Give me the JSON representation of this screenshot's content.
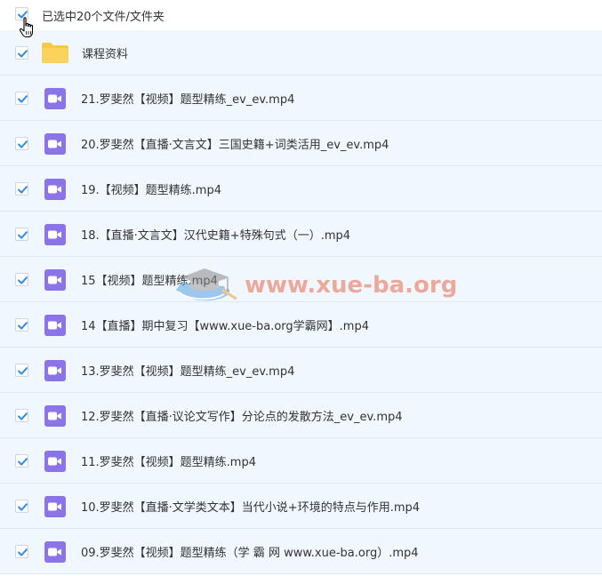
{
  "header": {
    "selection_label": "已选中20个文件/文件夹",
    "select_all_checked": true
  },
  "watermark": {
    "text": "www.xue-ba.org",
    "icon": "graduation-cap-icon"
  },
  "colors": {
    "row_bg": "#f1f7fe",
    "checkbox_check": "#2f8df0",
    "video_icon_bg": "#8b74e8",
    "folder": "#f7c843",
    "watermark": "#e85d3b"
  },
  "items": [
    {
      "type": "folder",
      "name": "课程资料",
      "checked": true,
      "icon": "folder-icon"
    },
    {
      "type": "video",
      "name": "21.罗斐然【视频】题型精练_ev_ev.mp4",
      "checked": true,
      "icon": "video-file-icon"
    },
    {
      "type": "video",
      "name": "20.罗斐然【直播·文言文】三国史籍+词类活用_ev_ev.mp4",
      "checked": true,
      "icon": "video-file-icon"
    },
    {
      "type": "video",
      "name": "19.【视频】题型精练.mp4",
      "checked": true,
      "icon": "video-file-icon"
    },
    {
      "type": "video",
      "name": "18.【直播·文言文】汉代史籍+特殊句式（一）.mp4",
      "checked": true,
      "icon": "video-file-icon"
    },
    {
      "type": "video",
      "name": "15【视频】题型精练.mp4",
      "checked": true,
      "icon": "video-file-icon"
    },
    {
      "type": "video",
      "name": "14【直播】期中复习【www.xue-ba.org学霸网】.mp4",
      "checked": true,
      "icon": "video-file-icon"
    },
    {
      "type": "video",
      "name": "13.罗斐然【视频】题型精练_ev_ev.mp4",
      "checked": true,
      "icon": "video-file-icon"
    },
    {
      "type": "video",
      "name": "12.罗斐然【直播·议论文写作】分论点的发散方法_ev_ev.mp4",
      "checked": true,
      "icon": "video-file-icon"
    },
    {
      "type": "video",
      "name": "11.罗斐然【视频】题型精练.mp4",
      "checked": true,
      "icon": "video-file-icon"
    },
    {
      "type": "video",
      "name": "10.罗斐然【直播·文学类文本】当代小说+环境的特点与作用.mp4",
      "checked": true,
      "icon": "video-file-icon"
    },
    {
      "type": "video",
      "name": "09.罗斐然【视频】题型精练（学 霸 网 www.xue-ba.org）.mp4",
      "checked": true,
      "icon": "video-file-icon"
    }
  ]
}
